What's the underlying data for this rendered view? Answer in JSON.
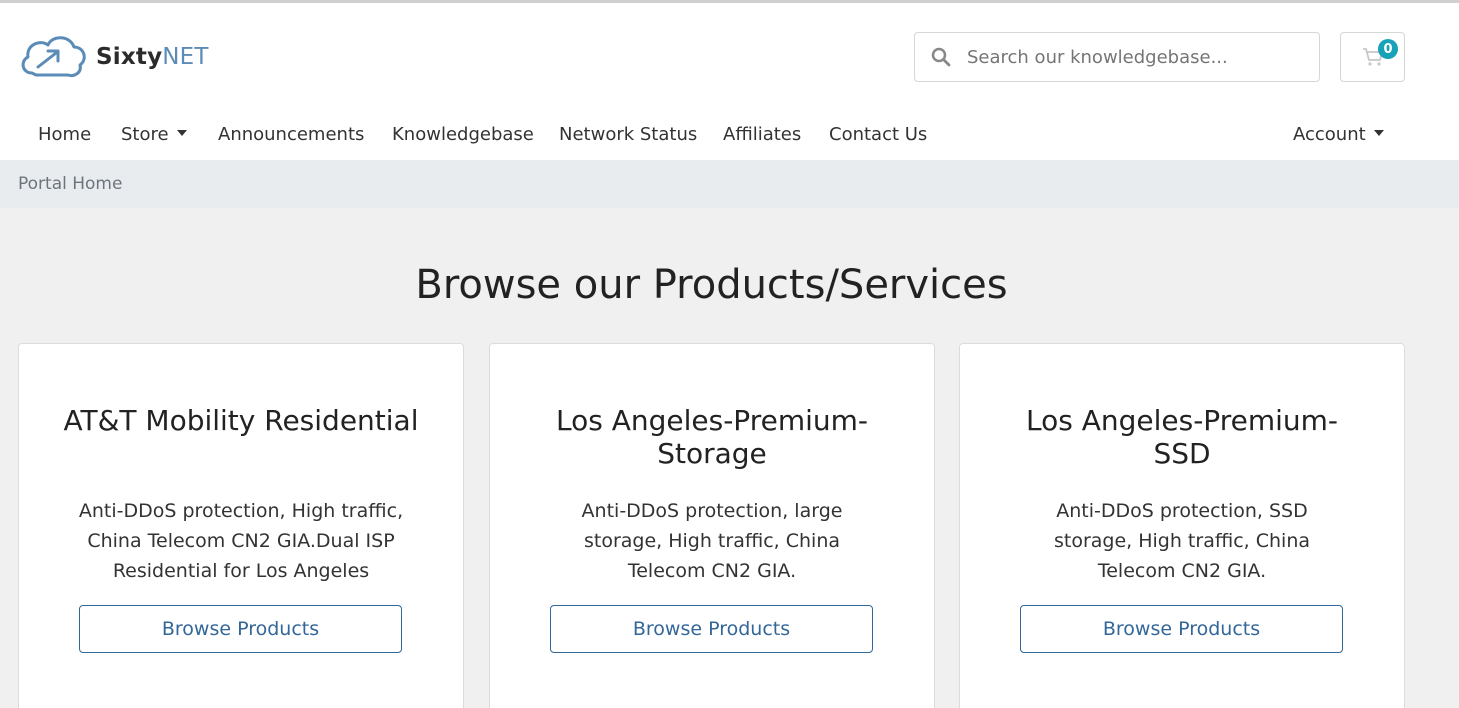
{
  "brand": {
    "name_main": "Sixty",
    "name_accent": "NET",
    "accent_color": "#5b8cb8"
  },
  "search": {
    "placeholder": "Search our knowledgebase...",
    "value": ""
  },
  "cart": {
    "count": "0",
    "badge_color": "#17a2b8"
  },
  "nav": {
    "home": "Home",
    "store": "Store",
    "announcements": "Announcements",
    "knowledgebase": "Knowledgebase",
    "network_status": "Network Status",
    "affiliates": "Affiliates",
    "contact_us": "Contact Us",
    "account": "Account"
  },
  "breadcrumb": {
    "current": "Portal Home"
  },
  "page_title": "Browse our Products/Services",
  "products": [
    {
      "title": "AT&T Mobility Residential",
      "description": "Anti-DDoS protection, High traffic, China Telecom CN2 GIA.Dual ISP Residential for Los Angeles",
      "button": "Browse Products"
    },
    {
      "title": "Los Angeles-Premium-Storage",
      "description": "Anti-DDoS protection, large storage, High traffic, China Telecom CN2 GIA.",
      "button": "Browse Products"
    },
    {
      "title": "Los Angeles-Premium-SSD",
      "description": "Anti-DDoS protection, SSD storage, High traffic, China Telecom CN2 GIA.",
      "button": "Browse Products"
    }
  ],
  "colors": {
    "link": "#336699",
    "breadcrumb_bg": "#e9ecef",
    "page_bg": "#f0f0f0"
  }
}
